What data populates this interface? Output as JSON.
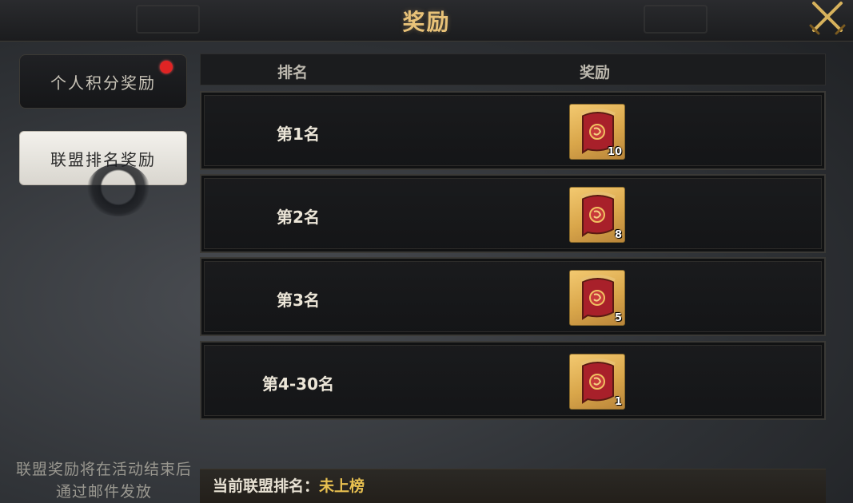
{
  "header": {
    "title": "奖励",
    "close_icon": "crossed-swords-close-icon"
  },
  "sidebar": {
    "tabs": [
      {
        "label": "个人积分奖励",
        "active": false,
        "has_notification": true
      },
      {
        "label": "联盟排名奖励",
        "active": true,
        "has_notification": false
      }
    ],
    "note": "联盟奖励将在活动结束后通过邮件发放"
  },
  "table": {
    "headers": {
      "rank": "排名",
      "reward": "奖励"
    },
    "rows": [
      {
        "rank": "第1名",
        "reward_icon": "banner-icon",
        "reward_count": "10"
      },
      {
        "rank": "第2名",
        "reward_icon": "banner-icon",
        "reward_count": "8"
      },
      {
        "rank": "第3名",
        "reward_icon": "banner-icon",
        "reward_count": "5"
      },
      {
        "rank": "第4-30名",
        "reward_icon": "banner-icon",
        "reward_count": "1"
      }
    ]
  },
  "status": {
    "label": "当前联盟排名：",
    "value": "未上榜"
  },
  "colors": {
    "title_gold": "#e8c278",
    "status_value": "#e8c050",
    "notification_red": "#e02424"
  }
}
